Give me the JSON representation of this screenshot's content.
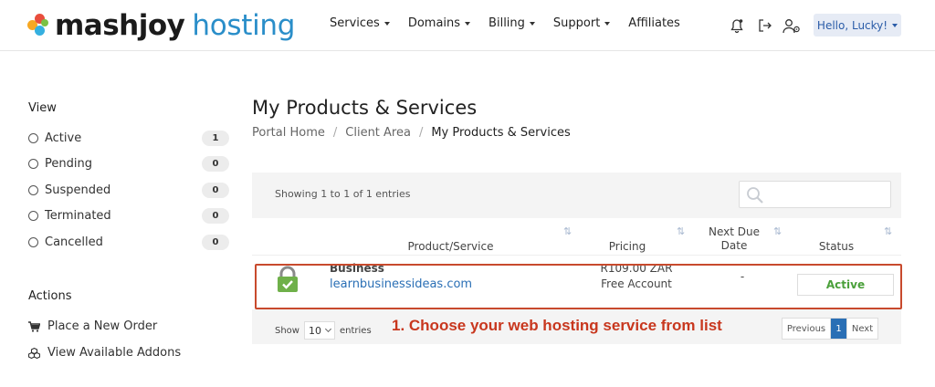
{
  "brand": {
    "name": "mashjoy",
    "sub": "hosting"
  },
  "nav": [
    {
      "label": "Services"
    },
    {
      "label": "Domains"
    },
    {
      "label": "Billing"
    },
    {
      "label": "Support"
    },
    {
      "label": "Affiliates"
    }
  ],
  "user": {
    "greeting": "Hello, Lucky!"
  },
  "sidebar": {
    "view_title": "View",
    "filters": [
      {
        "label": "Active",
        "count": "1"
      },
      {
        "label": "Pending",
        "count": "0"
      },
      {
        "label": "Suspended",
        "count": "0"
      },
      {
        "label": "Terminated",
        "count": "0"
      },
      {
        "label": "Cancelled",
        "count": "0"
      }
    ],
    "actions_title": "Actions",
    "actions": [
      {
        "label": "Place a New Order",
        "icon": "cart-icon"
      },
      {
        "label": "View Available Addons",
        "icon": "cubes-icon"
      }
    ]
  },
  "page": {
    "title": "My Products & Services",
    "breadcrumb": [
      "Portal Home",
      "Client Area",
      "My Products & Services"
    ]
  },
  "table": {
    "showing": "Showing 1 to 1 of 1 entries",
    "columns": {
      "product": "Product/Service",
      "pricing": "Pricing",
      "due_line1": "Next Due",
      "due_line2": "Date",
      "status": "Status"
    },
    "rows": [
      {
        "name": "Business",
        "domain": "learnbusinessideas.com",
        "price": "R109.00 ZAR",
        "cycle": "Free Account",
        "due": "-",
        "status": "Active"
      }
    ],
    "show_label": "Show",
    "page_size": "10",
    "entries_label": "entries",
    "pager": {
      "prev": "Previous",
      "current": "1",
      "next": "Next"
    }
  },
  "annotation": "1. Choose your web hosting service from list",
  "colors": {
    "brand_blue": "#2a8ec9",
    "active_green": "#4aa03a",
    "annotation_red": "#c8371e",
    "page_current": "#2a6fb5"
  }
}
